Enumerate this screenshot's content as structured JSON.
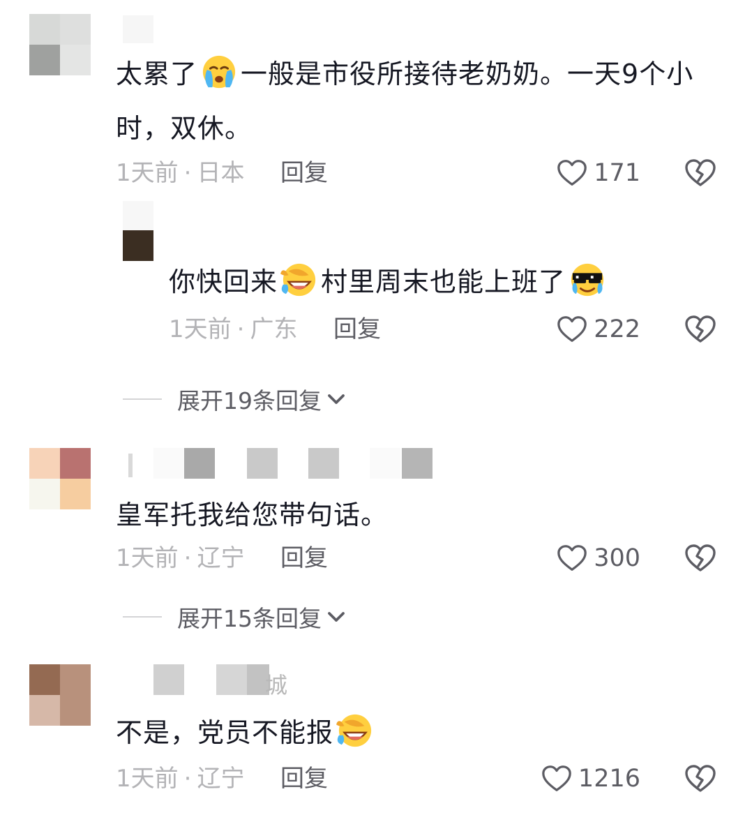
{
  "comments": [
    {
      "text_before": "太累了",
      "text_after": "一般是市役所接待老奶奶。一天9个小",
      "text_line2": "时，双休。",
      "emoji_name": "crying-emoji",
      "time": "1天前",
      "location": "日本",
      "reply": "回复",
      "likes": "171"
    },
    {
      "text_p1": "你快回来",
      "text_p2": "村里周末也能上班了",
      "emoji1_name": "rofl-emoji",
      "emoji2_name": "cool-tears-emoji",
      "time": "1天前",
      "location": "广东",
      "reply": "回复",
      "likes": "222"
    },
    {
      "text": "皇军托我给您带句话。",
      "time": "1天前",
      "location": "辽宁",
      "reply": "回复",
      "likes": "300"
    },
    {
      "username_visible": "城",
      "text": "不是，党员不能报",
      "emoji_name": "rofl-emoji",
      "time": "1天前",
      "location": "辽宁",
      "reply": "回复",
      "likes": "1216"
    }
  ],
  "expand_1": "展开19条回复",
  "expand_2": "展开15条回复",
  "meta_separator": "·",
  "icons": {
    "like": "heart-outline-icon",
    "dislike": "broken-heart-icon",
    "expand": "chevron-down-icon"
  },
  "colors": {
    "text": "#161823",
    "meta": "#b3b3b6",
    "secondary": "#5c5c63"
  }
}
